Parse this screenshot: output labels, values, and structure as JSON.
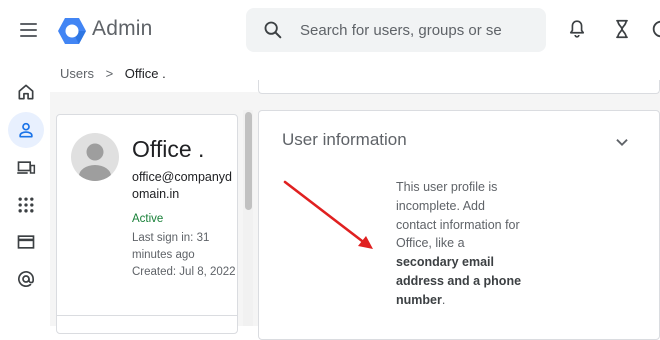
{
  "header": {
    "app_title": "Admin",
    "search_placeholder": "Search for users, groups or se"
  },
  "breadcrumb": {
    "parent": "Users",
    "separator": ">",
    "current": "Office ."
  },
  "rail": {
    "items": [
      "home-icon",
      "users-icon",
      "devices-icon",
      "apps-icon",
      "billing-icon",
      "account-icon"
    ],
    "active": "users-icon"
  },
  "user_card": {
    "name": "Office .",
    "email": "office@companydomain.in",
    "status": "Active",
    "last_sign_in": "Last sign in: 31 minutes ago",
    "created": "Created: Jul 8, 2022"
  },
  "user_information": {
    "title": "User information",
    "message_prefix": "This user profile is incomplete. Add contact information for Office, like a",
    "message_bold": "secondary email address and a phone number",
    "message_suffix": "."
  },
  "colors": {
    "accent": "#1a73e8",
    "active_status": "#188038",
    "annotation_arrow": "#e02020"
  }
}
